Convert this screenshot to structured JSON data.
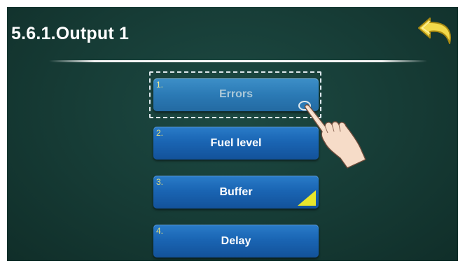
{
  "header": {
    "title": "5.6.1.Output 1"
  },
  "back_button": {
    "icon": "back-arrow-icon",
    "color": "#f2d94a"
  },
  "menu": {
    "items": [
      {
        "number": "1.",
        "label": "Errors"
      },
      {
        "number": "2.",
        "label": "Fuel level"
      },
      {
        "number": "3.",
        "label": "Buffer"
      },
      {
        "number": "4.",
        "label": "Delay"
      }
    ]
  },
  "colors": {
    "background": "#163b35",
    "button": "#1a65b3",
    "number": "#e8e07a",
    "corner_marker": "#e9e62b"
  }
}
